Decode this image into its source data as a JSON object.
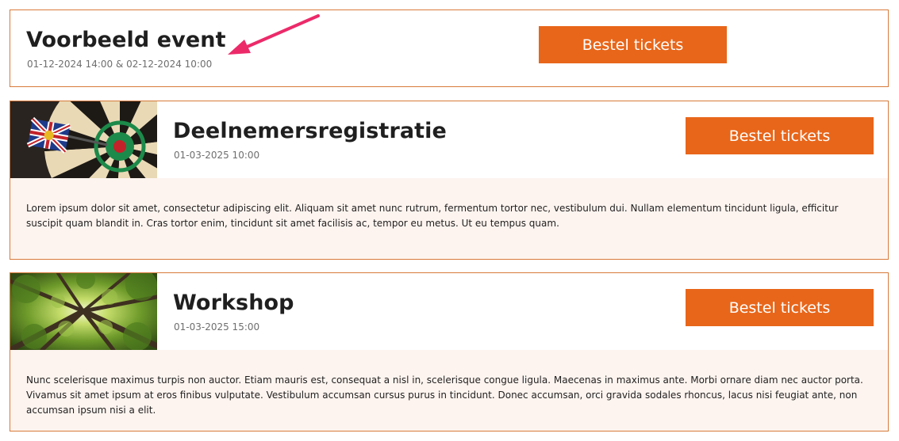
{
  "events": [
    {
      "title": "Voorbeeld event",
      "date": "01-12-2024 14:00 & 02-12-2024 10:00",
      "button_label": "Bestel tickets"
    },
    {
      "title": "Deelnemersregistratie",
      "date": "01-03-2025 10:00",
      "button_label": "Bestel tickets",
      "image": "dartboard-image",
      "description": "Lorem ipsum dolor sit amet, consectetur adipiscing elit. Aliquam sit amet nunc rutrum, fermentum tortor nec, vestibulum dui. Nullam elementum tincidunt ligula, efficitur suscipit quam blandit in. Cras tortor enim, tincidunt sit amet facilisis ac, tempor eu metus. Ut eu tempus quam."
    },
    {
      "title": "Workshop",
      "date": "01-03-2025 15:00",
      "button_label": "Bestel tickets",
      "image": "forest-canopy-image",
      "description": "Nunc scelerisque maximus turpis non auctor. Etiam mauris est, consequat a nisl in, scelerisque congue ligula. Maecenas in maximus ante. Morbi ornare diam nec auctor porta. Vivamus sit amet ipsum at eros finibus vulputate. Vestibulum accumsan cursus purus in tincidunt. Donec accumsan, orci gravida sodales rhoncus, lacus nisi feugiat ante, non accumsan ipsum nisi a elit."
    }
  ],
  "colors": {
    "accent": "#e8661a",
    "card_border": "#d87a3a",
    "description_bg": "#fdf4ef",
    "annotation_arrow": "#ec2a6a"
  },
  "annotation": "arrow-pointer-icon"
}
